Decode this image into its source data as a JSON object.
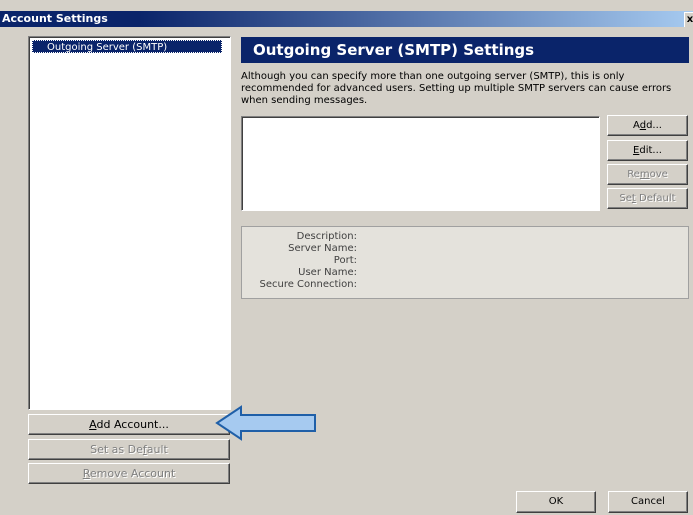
{
  "window": {
    "title": "Account Settings",
    "close_glyph": "x"
  },
  "tree": {
    "items": [
      {
        "label": "Outgoing Server (SMTP)",
        "selected": true
      }
    ]
  },
  "left_buttons": {
    "add_account": {
      "pre": "",
      "mnemonic": "A",
      "post": "dd Account..."
    },
    "set_default": {
      "pre": "Set as De",
      "mnemonic": "f",
      "post": "ault"
    },
    "remove_account": {
      "pre": "",
      "mnemonic": "R",
      "post": "emove Account"
    }
  },
  "panel": {
    "title": "Outgoing Server (SMTP) Settings",
    "description": "Although you can specify more than one outgoing server (SMTP), this is only recommended for advanced users. Setting up multiple SMTP servers can cause errors when sending messages."
  },
  "server_buttons": {
    "add": {
      "pre": "A",
      "mnemonic": "d",
      "post": "d..."
    },
    "edit": {
      "pre": "",
      "mnemonic": "E",
      "post": "dit..."
    },
    "remove": {
      "pre": "Re",
      "mnemonic": "m",
      "post": "ove"
    },
    "set_default": {
      "pre": "Se",
      "mnemonic": "t",
      "post": " Default"
    }
  },
  "details": {
    "description": "Description:",
    "server_name": "Server Name:",
    "port": "Port:",
    "user_name": "User Name:",
    "secure_connection": "Secure Connection:"
  },
  "footer": {
    "ok": "OK",
    "cancel": "Cancel"
  },
  "colors": {
    "title_active": "#0a246a",
    "dialog_bg": "#d4d0c8",
    "arrow_fill": "#a6caf0",
    "arrow_stroke": "#1f5fa8"
  }
}
